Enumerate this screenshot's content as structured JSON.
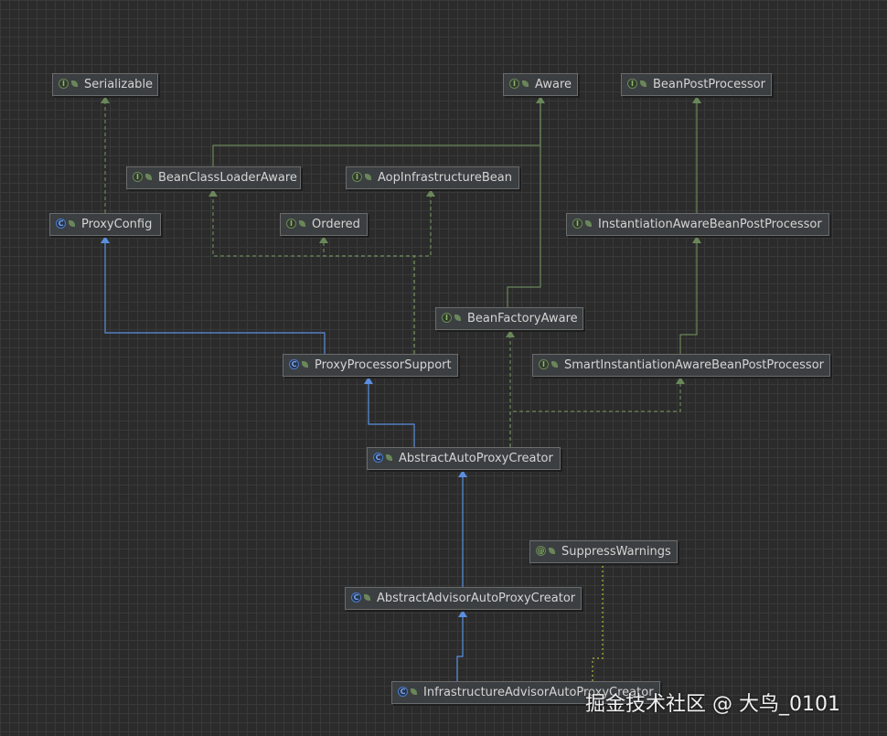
{
  "nodes": {
    "serializable": {
      "label": "Serializable",
      "kind": "interface",
      "kind_glyph": "I"
    },
    "aware": {
      "label": "Aware",
      "kind": "interface",
      "kind_glyph": "I"
    },
    "bean_post_processor": {
      "label": "BeanPostProcessor",
      "kind": "interface",
      "kind_glyph": "I"
    },
    "bean_class_loader_aware": {
      "label": "BeanClassLoaderAware",
      "kind": "interface",
      "kind_glyph": "I"
    },
    "aop_infrastructure_bean": {
      "label": "AopInfrastructureBean",
      "kind": "interface",
      "kind_glyph": "I"
    },
    "proxy_config": {
      "label": "ProxyConfig",
      "kind": "class",
      "kind_glyph": "C"
    },
    "ordered": {
      "label": "Ordered",
      "kind": "interface",
      "kind_glyph": "I"
    },
    "instantiation_aware_bpp": {
      "label": "InstantiationAwareBeanPostProcessor",
      "kind": "interface",
      "kind_glyph": "I"
    },
    "bean_factory_aware": {
      "label": "BeanFactoryAware",
      "kind": "interface",
      "kind_glyph": "I"
    },
    "proxy_processor_support": {
      "label": "ProxyProcessorSupport",
      "kind": "class",
      "kind_glyph": "C"
    },
    "smart_instantiation_aware_bpp": {
      "label": "SmartInstantiationAwareBeanPostProcessor",
      "kind": "interface",
      "kind_glyph": "I"
    },
    "abstract_auto_proxy_creator": {
      "label": "AbstractAutoProxyCreator",
      "kind": "abstract class",
      "kind_glyph": "C"
    },
    "suppress_warnings": {
      "label": "SuppressWarnings",
      "kind": "annotation",
      "kind_glyph": "@"
    },
    "abstract_advisor_auto_proxy_creator": {
      "label": "AbstractAdvisorAutoProxyCreator",
      "kind": "abstract class",
      "kind_glyph": "C"
    },
    "infrastructure_advisor_auto_proxy_creator": {
      "label": "InfrastructureAdvisorAutoProxyCreator",
      "kind": "class",
      "kind_glyph": "C"
    }
  },
  "edges": [
    {
      "from": "proxy_config",
      "to": "serializable",
      "type": "implements"
    },
    {
      "from": "bean_class_loader_aware",
      "to": "aware",
      "type": "extends-interface"
    },
    {
      "from": "bean_factory_aware",
      "to": "aware",
      "type": "extends-interface"
    },
    {
      "from": "instantiation_aware_bpp",
      "to": "bean_post_processor",
      "type": "extends-interface"
    },
    {
      "from": "smart_instantiation_aware_bpp",
      "to": "instantiation_aware_bpp",
      "type": "extends-interface"
    },
    {
      "from": "proxy_processor_support",
      "to": "proxy_config",
      "type": "extends"
    },
    {
      "from": "proxy_processor_support",
      "to": "ordered",
      "type": "implements"
    },
    {
      "from": "proxy_processor_support",
      "to": "bean_class_loader_aware",
      "type": "implements"
    },
    {
      "from": "proxy_processor_support",
      "to": "aop_infrastructure_bean",
      "type": "implements"
    },
    {
      "from": "abstract_auto_proxy_creator",
      "to": "proxy_processor_support",
      "type": "extends"
    },
    {
      "from": "abstract_auto_proxy_creator",
      "to": "smart_instantiation_aware_bpp",
      "type": "implements"
    },
    {
      "from": "abstract_auto_proxy_creator",
      "to": "bean_factory_aware",
      "type": "implements"
    },
    {
      "from": "abstract_advisor_auto_proxy_creator",
      "to": "abstract_auto_proxy_creator",
      "type": "extends"
    },
    {
      "from": "infrastructure_advisor_auto_proxy_creator",
      "to": "abstract_advisor_auto_proxy_creator",
      "type": "extends"
    },
    {
      "from": "infrastructure_advisor_auto_proxy_creator",
      "to": "suppress_warnings",
      "type": "annotated"
    }
  ],
  "colors": {
    "extends": "#5a8fe0",
    "implements": "#6a8759",
    "annotated": "#b5b83a",
    "node_bg": "#3c3f41",
    "text": "#d4d4d4"
  },
  "watermark": "掘金技术社区 @ 大鸟_0101"
}
